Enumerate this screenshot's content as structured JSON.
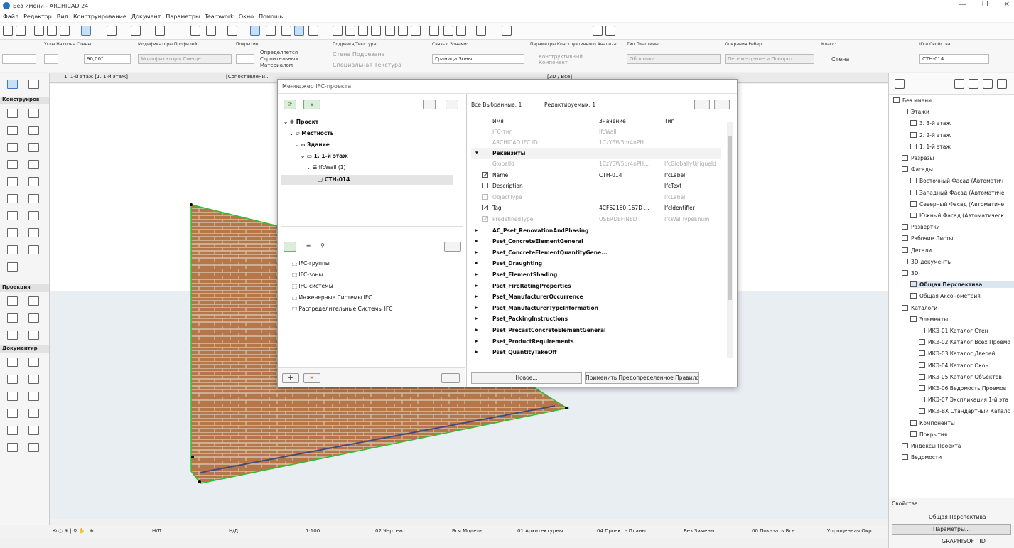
{
  "window": {
    "title": "Без имени - ARCHICAD 24"
  },
  "menu": [
    "Файл",
    "Редактор",
    "Вид",
    "Конструирование",
    "Документ",
    "Параметры",
    "Teamwork",
    "Окно",
    "Помощь"
  ],
  "infobox": {
    "slant_label": "Углы Наклона Стены:",
    "slant_value": "90,00°",
    "modifiers_label": "Модификаторы Профилей:",
    "modifiers_value": "Модификаторы Смеще...",
    "surface_label": "Покрытие:",
    "surface_line1": "Определяется",
    "surface_line2": "Строительным",
    "surface_line3": "Материалом",
    "texture_label": "Подрезка/Текстура:",
    "texture_line1": "Стена Подрезана",
    "texture_line2": "Специальная Текстура",
    "zone_label": "Связь с Зонами:",
    "zone_value": "Граница Зоны",
    "analysis_label": "Параметры Конструктивного Анализа:",
    "analysis_value": "Конструктивный Компонент",
    "plate_label": "Тип Пластины:",
    "plate_value": "Оболочка",
    "edge_label": "Опирания Ребер:",
    "edge_value": "Перемещение и Поворот...",
    "class_label": "Класс:",
    "class_value": "Стена",
    "id_label": "ID и Свойства:",
    "id_value": "СТН-014"
  },
  "tabs": [
    "1. 1-й этаж [1. 1-й этаж]",
    "[Сопоставлени...",
    "[3D / Все]"
  ],
  "toolbox": {
    "sections": [
      "Конструиров",
      "Проекция",
      "Документир"
    ]
  },
  "dialog": {
    "title": "Менеджер IFC-проекта",
    "tree": [
      {
        "label": "Проект",
        "bold": true
      },
      {
        "label": "Местность",
        "bold": true
      },
      {
        "label": "Здание",
        "bold": true
      },
      {
        "label": "1. 1-й этаж",
        "bold": true
      },
      {
        "label": "IfcWall (1)",
        "bold": false
      },
      {
        "label": "СТН-014",
        "bold": true
      }
    ],
    "groups": [
      "IFC-группы",
      "IFC-зоны",
      "IFC-системы",
      "Инженерные Системы IFC",
      "Распределительные Системы IFC"
    ],
    "selected_all": "Все Выбранные: 1",
    "editable": "Редактируемых: 1",
    "col_name": "Имя",
    "col_value": "Значение",
    "col_type": "Тип",
    "top_rows": [
      {
        "name": "IFC-тип",
        "value": "IfcWall",
        "type": ""
      },
      {
        "name": "ARCHICAD IFC ID",
        "value": "1CzY5W5dr4nPH...",
        "type": ""
      }
    ],
    "group_attr": "Реквизиты",
    "attr_rows": [
      {
        "name": "GlobalId",
        "value": "1CzY5W5dr4nPH...",
        "type": "IfcGloballyUniqueId",
        "cb": "none",
        "dim": true
      },
      {
        "name": "Name",
        "value": "СТН-014",
        "type": "IfcLabel",
        "cb": "on",
        "dim": false
      },
      {
        "name": "Description",
        "value": "",
        "type": "IfcText",
        "cb": "off",
        "dim": false
      },
      {
        "name": "ObjectType",
        "value": "",
        "type": "IfcLabel",
        "cb": "dimoff",
        "dim": true
      },
      {
        "name": "Tag",
        "value": "4CF62160-167D-...",
        "type": "IfcIdentifier",
        "cb": "on",
        "dim": false
      },
      {
        "name": "PredefinedType",
        "value": "USERDEFINED",
        "type": "IfcWallTypeEnum",
        "cb": "dimon",
        "dim": true
      }
    ],
    "psets": [
      "AC_Pset_RenovationAndPhasing",
      "Pset_ConcreteElementGeneral",
      "Pset_ConcreteElementQuantityGene...",
      "Pset_Draughting",
      "Pset_ElementShading",
      "Pset_FireRatingProperties",
      "Pset_ManufacturerOccurrence",
      "Pset_ManufacturerTypeInformation",
      "Pset_PackingInstructions",
      "Pset_PrecastConcreteElementGeneral",
      "Pset_ProductRequirements",
      "Pset_QuantityTakeOff"
    ],
    "btn_new": "Новое...",
    "btn_apply": "Применить Предопределенное Правило"
  },
  "navigator": {
    "rows": [
      {
        "label": "Без имени",
        "indent": 0,
        "hl": false
      },
      {
        "label": "Этажи",
        "indent": 1,
        "hl": false
      },
      {
        "label": "3. 3-й этаж",
        "indent": 2,
        "hl": false
      },
      {
        "label": "2. 2-й этаж",
        "indent": 2,
        "hl": false
      },
      {
        "label": "1. 1-й этаж",
        "indent": 2,
        "hl": false
      },
      {
        "label": "Разрезы",
        "indent": 1,
        "hl": false
      },
      {
        "label": "Фасады",
        "indent": 1,
        "hl": false
      },
      {
        "label": "Восточный Фасад (Автоматич",
        "indent": 2,
        "hl": false
      },
      {
        "label": "Западный Фасад (Автоматиче",
        "indent": 2,
        "hl": false
      },
      {
        "label": "Северный Фасад (Автоматиче",
        "indent": 2,
        "hl": false
      },
      {
        "label": "Южный Фасад (Автоматическ",
        "indent": 2,
        "hl": false
      },
      {
        "label": "Развертки",
        "indent": 1,
        "hl": false
      },
      {
        "label": "Рабочие Листы",
        "indent": 1,
        "hl": false
      },
      {
        "label": "Детали",
        "indent": 1,
        "hl": false
      },
      {
        "label": "3D-документы",
        "indent": 1,
        "hl": false
      },
      {
        "label": "3D",
        "indent": 1,
        "hl": false
      },
      {
        "label": "Общая Перспектива",
        "indent": 2,
        "hl": true
      },
      {
        "label": "Общая Аксонометрия",
        "indent": 2,
        "hl": false
      },
      {
        "label": "Каталоги",
        "indent": 1,
        "hl": false
      },
      {
        "label": "Элементы",
        "indent": 2,
        "hl": false
      },
      {
        "label": "ИКЭ-01 Каталог Стен",
        "indent": 3,
        "hl": false
      },
      {
        "label": "ИКЭ-02 Каталог Всех Проемо",
        "indent": 3,
        "hl": false
      },
      {
        "label": "ИКЭ-03 Каталог Дверей",
        "indent": 3,
        "hl": false
      },
      {
        "label": "ИКЭ-04 Каталог Окон",
        "indent": 3,
        "hl": false
      },
      {
        "label": "ИКЭ-05 Каталог Объектов",
        "indent": 3,
        "hl": false
      },
      {
        "label": "ИКЭ-06 Ведомость Проемов",
        "indent": 3,
        "hl": false
      },
      {
        "label": "ИКЭ-07 Экспликация 1-й эта",
        "indent": 3,
        "hl": false
      },
      {
        "label": "ИКЭ-ВХ Стандартный Каталс",
        "indent": 3,
        "hl": false
      },
      {
        "label": "Компоненты",
        "indent": 2,
        "hl": false
      },
      {
        "label": "Покрытия",
        "indent": 2,
        "hl": false
      },
      {
        "label": "Индексы Проекта",
        "indent": 1,
        "hl": false
      },
      {
        "label": "Ведомости",
        "indent": 1,
        "hl": false
      }
    ]
  },
  "props": {
    "header": "Свойства",
    "view": "Общая Перспектива",
    "settings": "Параметры...",
    "graphisoft": "GRAPHISOFT ID"
  },
  "statusbar": {
    "nd1": "Н/Д",
    "nd2": "Н/Д",
    "scale": "1:100",
    "layer": "02 Чертеж",
    "model": "Вся Модель",
    "combo1": "01 Архитектурны...",
    "combo2": "04 Проект - Планы",
    "override": "Без Замены",
    "reno": "00 Показать Все ...",
    "structure": "Упрощенная Окр..."
  },
  "colors": {
    "accent": "#3b7cc4",
    "wall_edge": "#2fbf2f",
    "brick": "#b5774a"
  }
}
